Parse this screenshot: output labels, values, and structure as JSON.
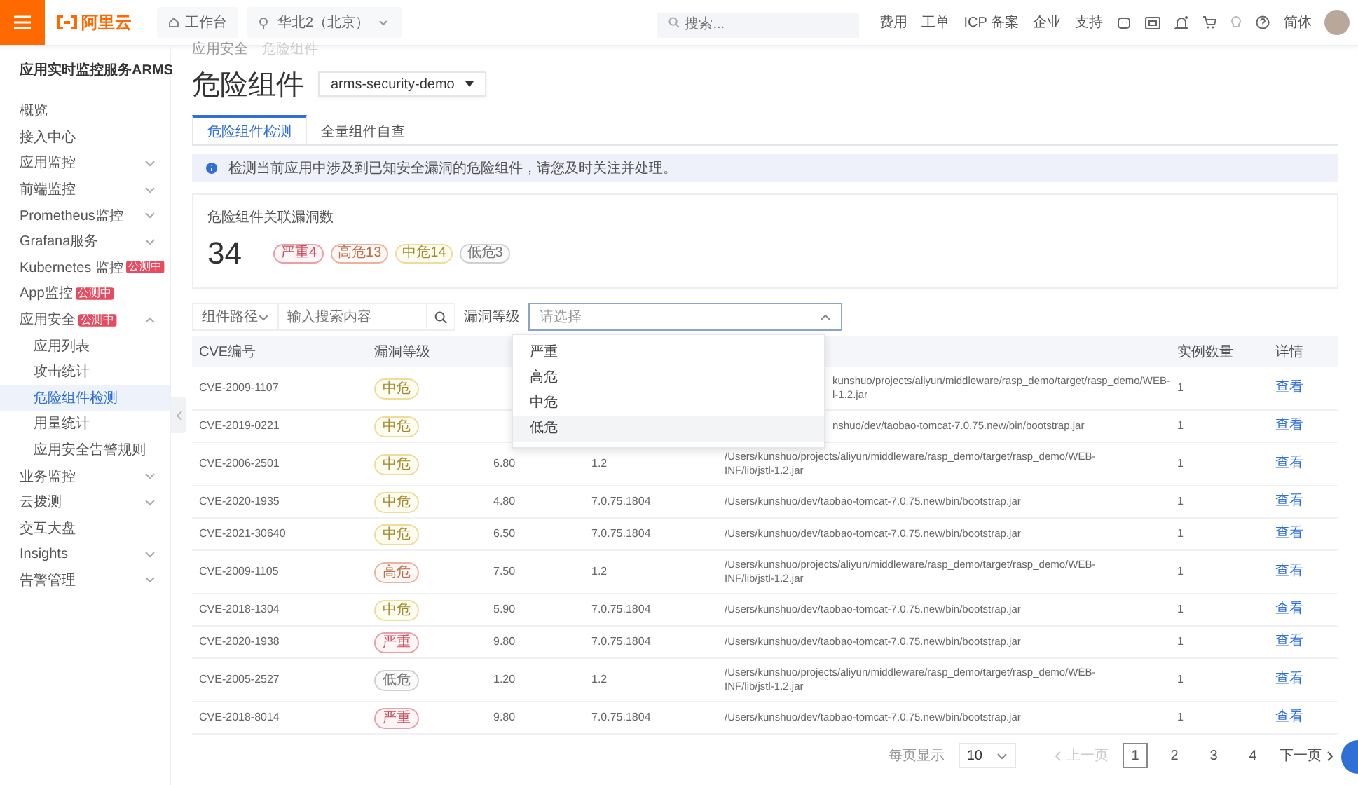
{
  "topbar": {
    "logo": "阿里云",
    "workbench": "工作台",
    "region": "华北2（北京）",
    "search_placeholder": "搜索...",
    "links": [
      "费用",
      "工单",
      "ICP 备案",
      "企业",
      "支持"
    ],
    "language": "简体"
  },
  "sidebar": {
    "title": "应用实时监控服务ARMS",
    "items": [
      {
        "label": "概览",
        "selected": false
      },
      {
        "label": "接入中心",
        "selected": false
      },
      {
        "label": "应用监控",
        "selected": false,
        "expanded": false
      },
      {
        "label": "前端监控",
        "selected": false,
        "expanded": false
      },
      {
        "label": "Prometheus监控",
        "selected": false,
        "expanded": false
      },
      {
        "label": "Grafana服务",
        "selected": false,
        "expanded": false
      },
      {
        "label": "Kubernetes 监控",
        "selected": false,
        "badge": "公测中"
      },
      {
        "label": "App监控",
        "selected": false,
        "badge": "公测中"
      },
      {
        "label": "应用安全",
        "selected": false,
        "badge": "公测中",
        "expanded": true,
        "children": [
          {
            "label": "应用列表",
            "selected": false
          },
          {
            "label": "攻击统计",
            "selected": false
          },
          {
            "label": "危险组件检测",
            "selected": true
          },
          {
            "label": "用量统计",
            "selected": false
          },
          {
            "label": "应用安全告警规则",
            "selected": false
          }
        ]
      },
      {
        "label": "业务监控",
        "selected": false,
        "expanded": false
      },
      {
        "label": "云拨测",
        "selected": false,
        "expanded": false
      },
      {
        "label": "交互大盘",
        "selected": false
      },
      {
        "label": "Insights",
        "selected": false,
        "expanded": false
      },
      {
        "label": "告警管理",
        "selected": false,
        "expanded": false
      }
    ]
  },
  "breadcrumb": [
    "应用安全",
    "危险组件"
  ],
  "title": "危险组件",
  "app_select": "arms-security-demo",
  "tabs": [
    {
      "label": "危险组件检测",
      "selected": true
    },
    {
      "label": "全量组件自查",
      "selected": false
    }
  ],
  "alert": "检测当前应用中涉及到已知安全漏洞的危险组件，请您及时关注并处理。",
  "summary": {
    "title": "危险组件关联漏洞数",
    "total": "34",
    "badges": [
      {
        "label": "严重4",
        "kind": "critical"
      },
      {
        "label": "高危13",
        "kind": "high"
      },
      {
        "label": "中危14",
        "kind": "medium"
      },
      {
        "label": "低危3",
        "kind": "low"
      }
    ]
  },
  "filter": {
    "path_select": "组件路径",
    "search_placeholder": "输入搜索内容",
    "level_label": "漏洞等级",
    "level_placeholder": "请选择",
    "open": true,
    "options": [
      {
        "label": "严重",
        "hovered": false
      },
      {
        "label": "高危",
        "hovered": false
      },
      {
        "label": "中危",
        "hovered": false
      },
      {
        "label": "低危",
        "hovered": true
      }
    ]
  },
  "table": {
    "header": {
      "cve": "CVE编号",
      "level": "漏洞等级",
      "instances": "实例数量",
      "details": "详情"
    },
    "rows": [
      {
        "cve": "CVE-2009-1107",
        "level": "中危",
        "kind": "medium",
        "covered": true,
        "path_lines": [
          "kunshuo/projects/aliyun/middleware/rasp_demo/target/rasp_demo/WEB-",
          "l-1.2.jar"
        ],
        "instances": "1",
        "link": "查看"
      },
      {
        "cve": "CVE-2019-0221",
        "level": "中危",
        "kind": "medium",
        "covered": true,
        "path_lines": [
          "nshuo/dev/taobao-tomcat-7.0.75.new/bin/bootstrap.jar"
        ],
        "instances": "1",
        "link": "查看"
      },
      {
        "cve": "CVE-2006-2501",
        "level": "中危",
        "kind": "medium",
        "covered": false,
        "score": "6.80",
        "version": "1.2",
        "path_lines": [
          "/Users/kunshuo/projects/aliyun/middleware/rasp_demo/target/rasp_demo/WEB-",
          "INF/lib/jstl-1.2.jar"
        ],
        "instances": "1",
        "link": "查看"
      },
      {
        "cve": "CVE-2020-1935",
        "level": "中危",
        "kind": "medium",
        "covered": false,
        "score": "4.80",
        "version": "7.0.75.1804",
        "path_lines": [
          "/Users/kunshuo/dev/taobao-tomcat-7.0.75.new/bin/bootstrap.jar"
        ],
        "instances": "1",
        "link": "查看"
      },
      {
        "cve": "CVE-2021-30640",
        "level": "中危",
        "kind": "medium",
        "covered": false,
        "score": "6.50",
        "version": "7.0.75.1804",
        "path_lines": [
          "/Users/kunshuo/dev/taobao-tomcat-7.0.75.new/bin/bootstrap.jar"
        ],
        "instances": "1",
        "link": "查看"
      },
      {
        "cve": "CVE-2009-1105",
        "level": "高危",
        "kind": "high",
        "covered": false,
        "score": "7.50",
        "version": "1.2",
        "path_lines": [
          "/Users/kunshuo/projects/aliyun/middleware/rasp_demo/target/rasp_demo/WEB-",
          "INF/lib/jstl-1.2.jar"
        ],
        "instances": "1",
        "link": "查看"
      },
      {
        "cve": "CVE-2018-1304",
        "level": "中危",
        "kind": "medium",
        "covered": false,
        "score": "5.90",
        "version": "7.0.75.1804",
        "path_lines": [
          "/Users/kunshuo/dev/taobao-tomcat-7.0.75.new/bin/bootstrap.jar"
        ],
        "instances": "1",
        "link": "查看"
      },
      {
        "cve": "CVE-2020-1938",
        "level": "严重",
        "kind": "critical",
        "covered": false,
        "score": "9.80",
        "version": "7.0.75.1804",
        "path_lines": [
          "/Users/kunshuo/dev/taobao-tomcat-7.0.75.new/bin/bootstrap.jar"
        ],
        "instances": "1",
        "link": "查看"
      },
      {
        "cve": "CVE-2005-2527",
        "level": "低危",
        "kind": "low",
        "covered": false,
        "score": "1.20",
        "version": "1.2",
        "path_lines": [
          "/Users/kunshuo/projects/aliyun/middleware/rasp_demo/target/rasp_demo/WEB-",
          "INF/lib/jstl-1.2.jar"
        ],
        "instances": "1",
        "link": "查看"
      },
      {
        "cve": "CVE-2018-8014",
        "level": "严重",
        "kind": "critical",
        "covered": false,
        "score": "9.80",
        "version": "7.0.75.1804",
        "path_lines": [
          "/Users/kunshuo/dev/taobao-tomcat-7.0.75.new/bin/bootstrap.jar"
        ],
        "instances": "1",
        "link": "查看"
      }
    ]
  },
  "pagination": {
    "page_size_label": "每页显示",
    "page_size": "10",
    "prev": "上一页",
    "prev_disabled": true,
    "pages": [
      {
        "label": "1",
        "selected": true
      },
      {
        "label": "2",
        "selected": false
      },
      {
        "label": "3",
        "selected": false
      },
      {
        "label": "4",
        "selected": false
      }
    ],
    "next": "下一页"
  }
}
